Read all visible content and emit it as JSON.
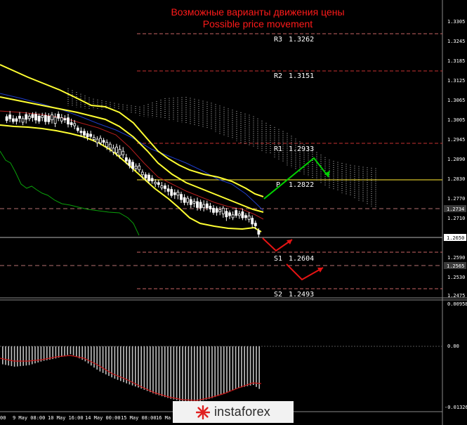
{
  "title_ru": "Возможные варианты движения цены",
  "title_en": "Possible price movement",
  "levels": [
    {
      "name": "R3",
      "value": "1.3262",
      "line_color": "#c86464",
      "dash": true
    },
    {
      "name": "R2",
      "value": "1.3151",
      "line_color": "#c83232",
      "dash": true
    },
    {
      "name": "R1",
      "value": "1.2933",
      "line_color": "#c83232",
      "dash": true
    },
    {
      "name": "P",
      "value": "1.2822",
      "line_color": "#d4c028",
      "dash": false
    },
    {
      "name": "S1",
      "value": "1.2604",
      "line_color": "#c86464",
      "dash": true
    },
    {
      "name": "S2",
      "value": "1.2493",
      "line_color": "#c86464",
      "dash": true
    }
  ],
  "price_axis": [
    "1.3305",
    "1.3245",
    "1.3185",
    "1.3125",
    "1.3065",
    "1.3005",
    "1.2945",
    "1.2890",
    "1.2830",
    "1.2770",
    "1.2710",
    "1.2650",
    "1.2590",
    "1.2530",
    "1.2475"
  ],
  "price_tags": [
    {
      "value": "1.2734",
      "bg": "#3a3a3a",
      "fg": "#ffffff"
    },
    {
      "value": "1.2650",
      "bg": "#ffffff",
      "fg": "#000000"
    },
    {
      "value": "1.2565",
      "bg": "#3a3a3a",
      "fg": "#ffffff"
    }
  ],
  "osc_axis": {
    "top": "0.00958",
    "zero": "0.00",
    "bottom": "-0.01326"
  },
  "dates": [
    "00",
    "9 May 08:00",
    "10 May 16:00",
    "14 May 00:00",
    "15 May 08:00",
    "16 Ma"
  ],
  "watermark": "instaforex",
  "colors": {
    "bg": "#000000",
    "candles": "#ffffff",
    "bollinger": "#ffff32",
    "ma_red": "#b41e1e",
    "ma_blue": "#1e3cc8",
    "chikou": "#0aa00a",
    "kumo": "#c8c8c8",
    "arrow_up": "#00d200",
    "arrow_down": "#e61414",
    "osc_bars": "#c0c0c0",
    "osc_line": "#c81414"
  }
}
